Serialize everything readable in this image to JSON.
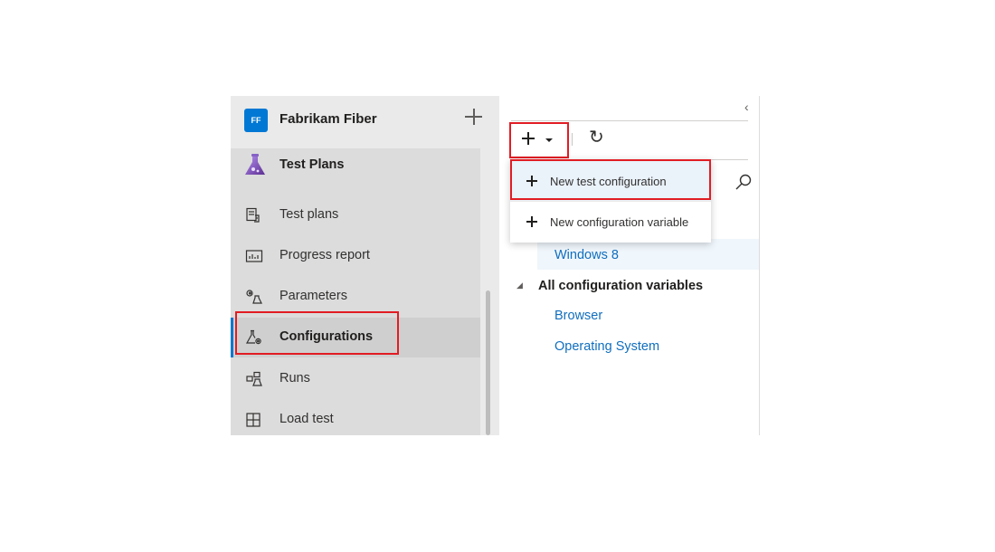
{
  "org": {
    "initials": "FF",
    "name": "Fabrikam Fiber",
    "brand_color": "#0078d4"
  },
  "nav": {
    "section_title": "Test Plans",
    "items": [
      {
        "label": "Test plans",
        "icon": "test-plans-icon"
      },
      {
        "label": "Progress report",
        "icon": "progress-report-icon"
      },
      {
        "label": "Parameters",
        "icon": "parameters-icon"
      },
      {
        "label": "Configurations",
        "icon": "configurations-icon",
        "selected": true
      },
      {
        "label": "Runs",
        "icon": "runs-icon"
      },
      {
        "label": "Load test",
        "icon": "load-test-icon"
      }
    ]
  },
  "toolbar": {
    "add_icon": "plus-icon",
    "dropdown_icon": "caret-down-icon",
    "refresh_glyph": "↻",
    "collapse_glyph": "‹"
  },
  "menu": {
    "items": [
      {
        "label": "New test configuration",
        "highlighted": true
      },
      {
        "label": "New configuration variable"
      }
    ]
  },
  "tree": {
    "configurations": [
      {
        "label": "Windows 8",
        "selected": true
      }
    ],
    "variables_header": "All configuration variables",
    "variables": [
      {
        "label": "Browser"
      },
      {
        "label": "Operating System"
      }
    ]
  },
  "colors": {
    "highlight_box": "#e21c23",
    "link": "#106ebe",
    "selected_accent": "#0078d4"
  }
}
